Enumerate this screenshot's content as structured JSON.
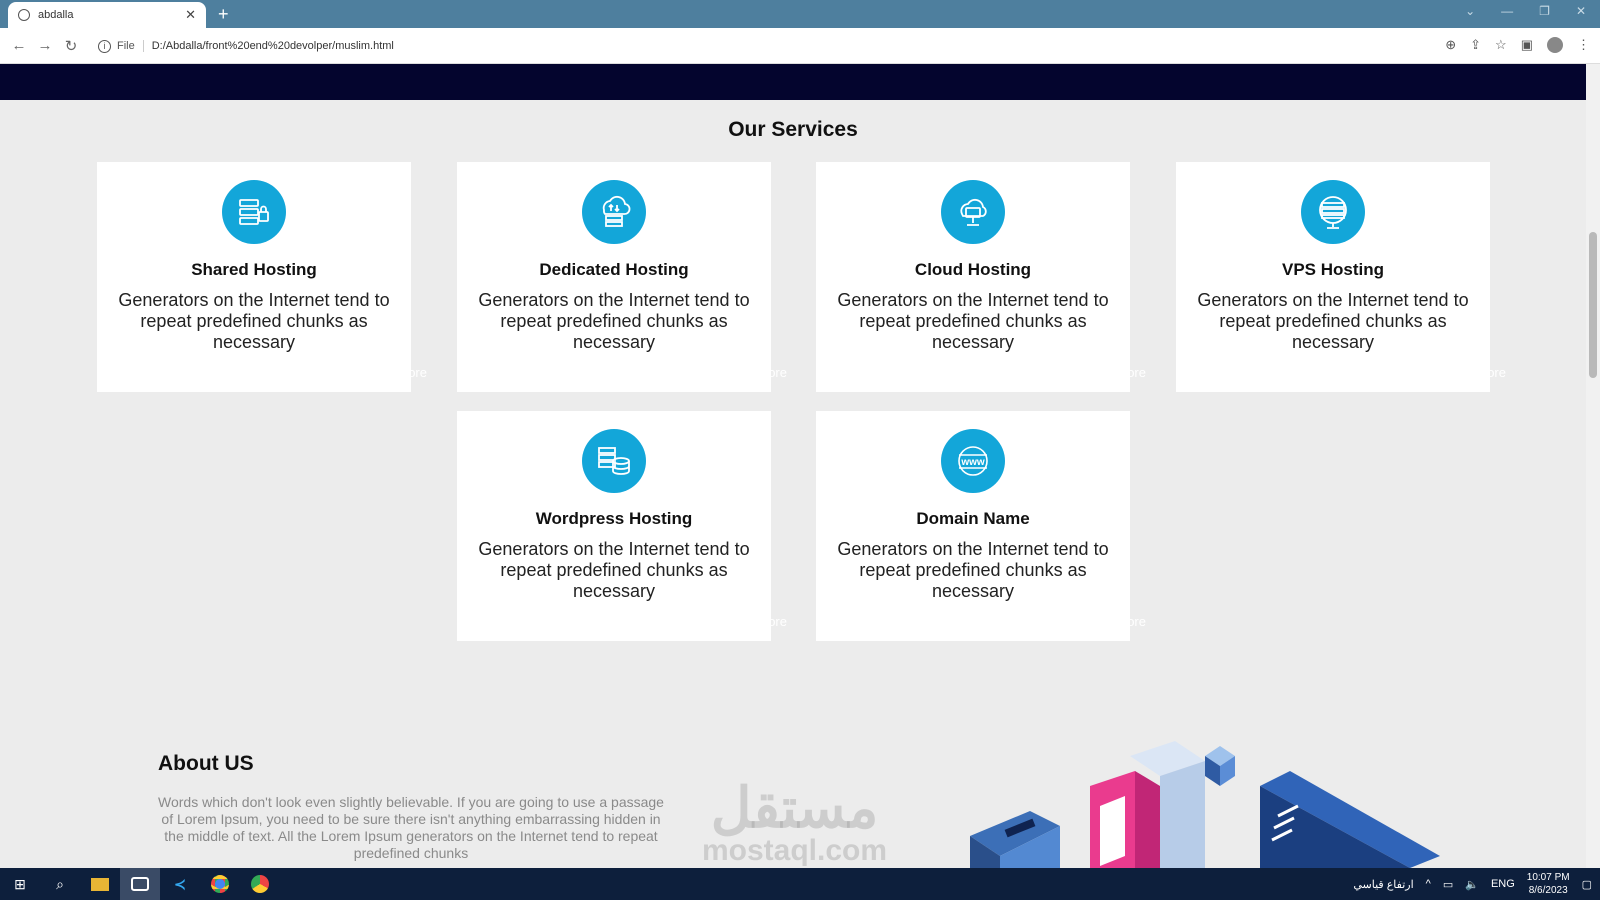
{
  "browser": {
    "tab_title": "abdalla",
    "url_prefix": "File",
    "url": "D:/Abdalla/front%20end%20devolper/muslim.html"
  },
  "services": {
    "title": "Our Services",
    "cards": [
      {
        "title": "Shared Hosting",
        "text": "Generators on the Internet tend to repeat predefined chunks as necessary",
        "more": "ore"
      },
      {
        "title": "Dedicated Hosting",
        "text": "Generators on the Internet tend to repeat predefined chunks as necessary",
        "more": "ore"
      },
      {
        "title": "Cloud Hosting",
        "text": "Generators on the Internet tend to repeat predefined chunks as necessary",
        "more": "ore"
      },
      {
        "title": "VPS Hosting",
        "text": "Generators on the Internet tend to repeat predefined chunks as necessary",
        "more": "ore"
      },
      {
        "title": "Wordpress Hosting",
        "text": "Generators on the Internet tend to repeat predefined chunks as necessary",
        "more": "ore"
      },
      {
        "title": "Domain Name",
        "text": "Generators on the Internet tend to repeat predefined chunks as necessary",
        "more": "ore"
      }
    ]
  },
  "about": {
    "title": "About US",
    "text": "Words which don't look even slightly believable. If you are going to use a passage of Lorem Ipsum, you need to be sure there isn't anything embarrassing hidden in the middle of text. All the Lorem Ipsum generators on the Internet tend to repeat predefined chunks"
  },
  "watermark": {
    "arabic": "مستقل",
    "latin": "mostaql.com"
  },
  "taskbar": {
    "weather": "ارتفاع قياسي",
    "lang": "ENG",
    "time": "10:07 PM",
    "date": "8/6/2023"
  }
}
